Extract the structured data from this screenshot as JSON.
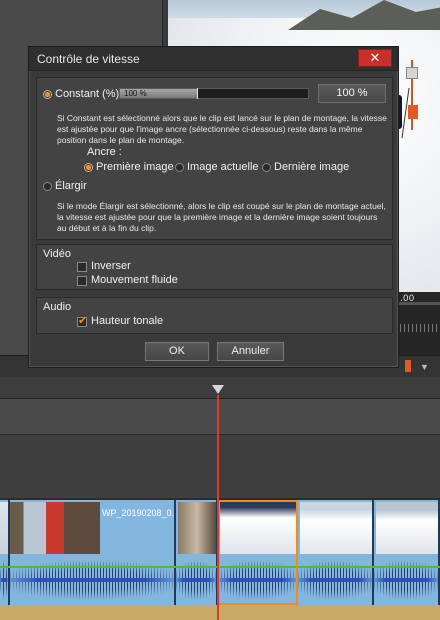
{
  "dialog": {
    "title": "Contrôle de vitesse",
    "close_glyph": "✕",
    "ok_label": "OK",
    "cancel_label": "Annuler"
  },
  "speed": {
    "constant_label": "Constant (%)",
    "constant_selected": true,
    "bar_value_text": "100 %",
    "bar_fill_fraction": 0.41,
    "field_value": "100 %",
    "constant_help": "Si Constant est sélectionné alors que le clip est lancé sur le plan de montage, la vitesse est ajustée pour que l'image ancre (sélectionnée ci-dessous) reste  dans la même position dans le plan de montage.",
    "anchor_label": "Ancre :",
    "anchor_options": [
      "Première image",
      "Image actuelle",
      "Dernière image"
    ],
    "anchor_selected": 0,
    "stretch_label": "Élargir",
    "stretch_selected": false,
    "stretch_help": "Si le mode Élargir est sélectionné, alors le clip est coupé sur le plan de montage actuel, la vitesse est ajustée pour que la première image et la dernière image soient toujours au début et à la fin du clip."
  },
  "video": {
    "section_label": "Vidéo",
    "reverse_label": "Inverser",
    "reverse_checked": false,
    "smooth_label": "Mouvement fluide",
    "smooth_checked": false
  },
  "audio": {
    "section_label": "Audio",
    "pitch_label": "Hauteur tonale",
    "pitch_checked": true
  },
  "preview": {
    "timecode_fragment": ".00"
  },
  "timeline": {
    "clip_label": "WP_20190208_0..."
  },
  "colors": {
    "accent": "#f0901e",
    "close": "#c6312b",
    "playhead": "#e23a2a",
    "selection": "#f08c1c",
    "clip_video": "#82b6df",
    "audio_line": "#3fc04a"
  }
}
